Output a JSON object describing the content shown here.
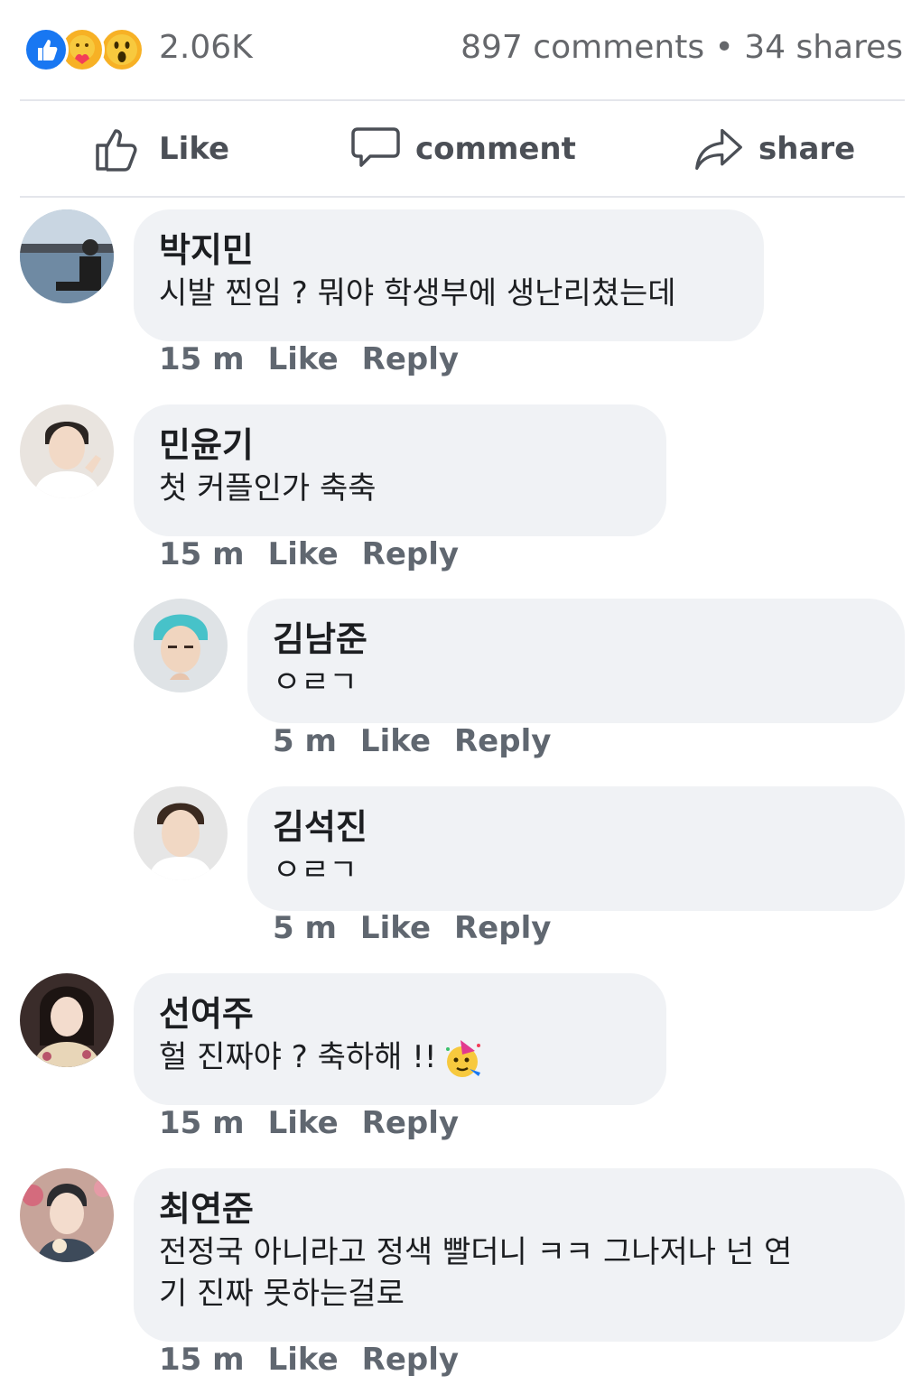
{
  "stats": {
    "reaction_count": "2.06K",
    "comments_shares": "897 comments • 34 shares",
    "reactions": [
      "like-icon",
      "care-icon",
      "wow-icon"
    ]
  },
  "actions": {
    "like": "Like",
    "comment": "comment",
    "share": "share"
  },
  "comments": [
    {
      "name": "박지민",
      "text": "시발 찐임 ? 뭐야 학생부에 생난리쳤는데",
      "time": "15 m",
      "like": "Like",
      "reply": "Reply"
    },
    {
      "name": "민윤기",
      "text": "첫 커플인가 축축",
      "time": "15 m",
      "like": "Like",
      "reply": "Reply",
      "replies": [
        {
          "name": "김남준",
          "text": "ㅇㄹㄱ",
          "time": "5 m",
          "like": "Like",
          "reply": "Reply"
        },
        {
          "name": "김석진",
          "text": "ㅇㄹㄱ",
          "time": "5 m",
          "like": "Like",
          "reply": "Reply"
        }
      ]
    },
    {
      "name": "선여주",
      "text": "헐 진짜야 ? 축하해 !!",
      "emoji": "partying-face-icon",
      "time": "15 m",
      "like": "Like",
      "reply": "Reply"
    },
    {
      "name": "최연준",
      "text_line1": "전정국 아니라고 정색 빨더니 ㅋㅋ 그나저나 넌 연",
      "text_line2": "기 진짜 못하는걸로",
      "time": "15 m",
      "like": "Like",
      "reply": "Reply"
    }
  ],
  "colors": {
    "brand_blue": "#1877f2",
    "bubble_bg": "#f0f2f5",
    "meta_text": "#606770"
  }
}
